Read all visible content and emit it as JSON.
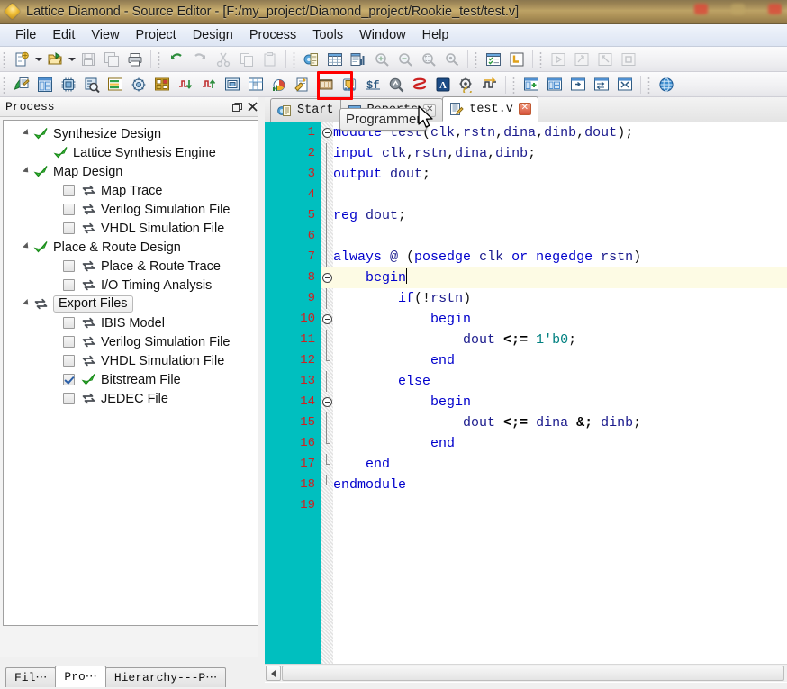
{
  "window": {
    "title": "Lattice Diamond - Source Editor - [F:/my_project/Diamond_project/Rookie_test/test.v]",
    "app_icon": "diamond-icon"
  },
  "menubar": {
    "items": [
      {
        "label": "File"
      },
      {
        "label": "Edit"
      },
      {
        "label": "View"
      },
      {
        "label": "Project"
      },
      {
        "label": "Design"
      },
      {
        "label": "Process"
      },
      {
        "label": "Tools"
      },
      {
        "label": "Window"
      },
      {
        "label": "Help"
      }
    ]
  },
  "toolbar_row1": {
    "groups": [
      {
        "buttons": [
          {
            "name": "new-file-icon",
            "kind": "newfile"
          },
          {
            "name": "new-file-dropdown-icon",
            "kind": "caret"
          },
          {
            "name": "open-file-icon",
            "kind": "openfile"
          },
          {
            "name": "open-file-dropdown-icon",
            "kind": "caret"
          },
          {
            "name": "save-icon",
            "kind": "save",
            "disabled": true
          },
          {
            "name": "save-all-icon",
            "kind": "saveall",
            "disabled": true
          },
          {
            "name": "print-icon",
            "kind": "print"
          }
        ]
      },
      {
        "buttons": [
          {
            "name": "undo-icon",
            "kind": "undo"
          },
          {
            "name": "redo-icon",
            "kind": "redo",
            "disabled": true
          },
          {
            "name": "cut-icon",
            "kind": "cut",
            "disabled": true
          },
          {
            "name": "copy-icon",
            "kind": "copy",
            "disabled": true
          },
          {
            "name": "paste-icon",
            "kind": "paste",
            "disabled": true
          }
        ]
      },
      {
        "buttons": [
          {
            "name": "report-icon",
            "kind": "report"
          },
          {
            "name": "spreadsheet-icon",
            "kind": "spreadsheet"
          },
          {
            "name": "find-in-files-icon",
            "kind": "findfiles"
          },
          {
            "name": "zoom-in-icon",
            "kind": "zoomin",
            "disabled": true
          },
          {
            "name": "zoom-out-icon",
            "kind": "zoomout",
            "disabled": true
          },
          {
            "name": "zoom-fit-icon",
            "kind": "zoomfit",
            "disabled": true
          },
          {
            "name": "zoom-select-icon",
            "kind": "zoomsel",
            "disabled": true
          }
        ]
      },
      {
        "buttons": [
          {
            "name": "task-list-icon",
            "kind": "tasklist"
          },
          {
            "name": "lattice-l-icon",
            "kind": "lattice"
          }
        ]
      },
      {
        "buttons": [
          {
            "name": "run-icon",
            "kind": "run",
            "disabled": true
          },
          {
            "name": "run-step-icon",
            "kind": "runstep",
            "disabled": true
          },
          {
            "name": "rerun-icon",
            "kind": "rerun",
            "disabled": true
          },
          {
            "name": "stop-icon",
            "kind": "stop",
            "disabled": true
          }
        ]
      }
    ]
  },
  "toolbar_row2": {
    "groups": [
      {
        "buttons": [
          {
            "name": "source-editor-icon",
            "kind": "srceditor"
          },
          {
            "name": "spreadsheet-view-icon",
            "kind": "sheetview"
          },
          {
            "name": "device-view-icon",
            "kind": "device"
          },
          {
            "name": "netlist-analyzer-icon",
            "kind": "netlist"
          },
          {
            "name": "floorplan-list-icon",
            "kind": "floorlist"
          },
          {
            "name": "package-view-icon",
            "kind": "package"
          },
          {
            "name": "floorplan-view-icon",
            "kind": "floorplan"
          },
          {
            "name": "timing-down-icon",
            "kind": "timingdown"
          },
          {
            "name": "timing-up-icon",
            "kind": "timingup"
          },
          {
            "name": "physical-view-icon",
            "kind": "physview"
          },
          {
            "name": "routing-view-icon",
            "kind": "routeview"
          },
          {
            "name": "power-calculator-icon",
            "kind": "power"
          },
          {
            "name": "ecо-editor-icon",
            "kind": "eco"
          },
          {
            "name": "memory-icon",
            "kind": "memory"
          },
          {
            "name": "programmer-icon",
            "kind": "programmer",
            "highlighted": true
          },
          {
            "name": "simulation-wizard-icon",
            "kind": "simwiz"
          },
          {
            "name": "reveal-inserter-icon",
            "kind": "reveal"
          },
          {
            "name": "reveal-analyzer-icon",
            "kind": "revealana"
          },
          {
            "name": "synplify-icon",
            "kind": "synplify"
          },
          {
            "name": "clarity-designer-icon",
            "kind": "clarity"
          },
          {
            "name": "timing-waveform-icon",
            "kind": "timingwave"
          }
        ]
      },
      {
        "buttons": [
          {
            "name": "new-window-icon",
            "kind": "newwin"
          },
          {
            "name": "tile-window-icon",
            "kind": "tilewin"
          },
          {
            "name": "float-window-icon",
            "kind": "floatwin"
          },
          {
            "name": "dock-window-icon",
            "kind": "dockwin"
          },
          {
            "name": "arrange-window-icon",
            "kind": "arrangewin"
          }
        ]
      },
      {
        "buttons": [
          {
            "name": "web-help-icon",
            "kind": "globe"
          }
        ]
      }
    ]
  },
  "process_panel": {
    "title": "Process",
    "float_button": "restore-icon",
    "close_button": "close-icon",
    "tree": [
      {
        "label": "Synthesize Design",
        "level": 0,
        "twisty": true,
        "checkbox": null,
        "icon": "green-check-icon"
      },
      {
        "label": "Lattice Synthesis Engine",
        "level": 1,
        "twisty": false,
        "checkbox": null,
        "icon": "green-check-icon"
      },
      {
        "label": "Map Design",
        "level": 0,
        "twisty": true,
        "checkbox": null,
        "icon": "green-check-icon"
      },
      {
        "label": "Map Trace",
        "level": 2,
        "twisty": false,
        "checkbox": "unchecked",
        "icon": "sync-arrows-icon"
      },
      {
        "label": "Verilog Simulation File",
        "level": 2,
        "twisty": false,
        "checkbox": "unchecked",
        "icon": "sync-arrows-icon"
      },
      {
        "label": "VHDL Simulation File",
        "level": 2,
        "twisty": false,
        "checkbox": "unchecked",
        "icon": "sync-arrows-icon"
      },
      {
        "label": "Place & Route Design",
        "level": 0,
        "twisty": true,
        "checkbox": null,
        "icon": "green-check-icon"
      },
      {
        "label": "Place & Route Trace",
        "level": 2,
        "twisty": false,
        "checkbox": "unchecked",
        "icon": "sync-arrows-icon"
      },
      {
        "label": "I/O Timing Analysis",
        "level": 2,
        "twisty": false,
        "checkbox": "unchecked",
        "icon": "sync-arrows-icon"
      },
      {
        "label": "Export Files",
        "level": 0,
        "twisty": true,
        "checkbox": null,
        "icon": "sync-arrows-icon",
        "selected": true
      },
      {
        "label": "IBIS Model",
        "level": 2,
        "twisty": false,
        "checkbox": "unchecked",
        "icon": "sync-arrows-icon"
      },
      {
        "label": "Verilog Simulation File",
        "level": 2,
        "twisty": false,
        "checkbox": "unchecked",
        "icon": "sync-arrows-icon"
      },
      {
        "label": "VHDL Simulation File",
        "level": 2,
        "twisty": false,
        "checkbox": "unchecked",
        "icon": "sync-arrows-icon"
      },
      {
        "label": "Bitstream File",
        "level": 2,
        "twisty": false,
        "checkbox": "checked",
        "icon": "green-check-icon"
      },
      {
        "label": "JEDEC File",
        "level": 2,
        "twisty": false,
        "checkbox": "unchecked",
        "icon": "sync-arrows-icon"
      }
    ],
    "bottom_tabs": [
      {
        "label": "Fil⋯",
        "active": false
      },
      {
        "label": "Pro⋯",
        "active": true
      },
      {
        "label": "Hierarchy---P⋯",
        "active": false
      }
    ]
  },
  "editor": {
    "tabs": [
      {
        "label": "Start",
        "icon": "start-page-icon",
        "closable": false,
        "active": false
      },
      {
        "label": "Reports",
        "icon": "reports-icon",
        "closable": true,
        "active": false
      },
      {
        "label": "test.v",
        "icon": "verilog-file-icon",
        "closable": true,
        "active": true
      }
    ],
    "gutter_color": "#00bfbf",
    "line_number_color": "#d02020",
    "highlight_line": 8,
    "cursor_line": 8,
    "lines": [
      {
        "n": 1,
        "fold": "open",
        "text": "module test(clk,rstn,dina,dinb,dout);"
      },
      {
        "n": 2,
        "fold": "bar",
        "text": "input clk,rstn,dina,dinb;"
      },
      {
        "n": 3,
        "fold": "bar",
        "text": "output dout;"
      },
      {
        "n": 4,
        "fold": "bar",
        "text": ""
      },
      {
        "n": 5,
        "fold": "bar",
        "text": "reg dout;"
      },
      {
        "n": 6,
        "fold": "bar",
        "text": ""
      },
      {
        "n": 7,
        "fold": "bar",
        "text": "always @ (posedge clk or negedge rstn)"
      },
      {
        "n": 8,
        "fold": "open",
        "text": "    begin"
      },
      {
        "n": 9,
        "fold": "bar",
        "text": "        if(!rstn)"
      },
      {
        "n": 10,
        "fold": "open",
        "text": "            begin"
      },
      {
        "n": 11,
        "fold": "bar",
        "text": "                dout <= 1'b0;"
      },
      {
        "n": 12,
        "fold": "end",
        "text": "            end"
      },
      {
        "n": 13,
        "fold": "bar",
        "text": "        else"
      },
      {
        "n": 14,
        "fold": "open",
        "text": "            begin"
      },
      {
        "n": 15,
        "fold": "bar",
        "text": "                dout <= dina & dinb;"
      },
      {
        "n": 16,
        "fold": "end",
        "text": "            end"
      },
      {
        "n": 17,
        "fold": "end",
        "text": "    end"
      },
      {
        "n": 18,
        "fold": "end",
        "text": "endmodule"
      },
      {
        "n": 19,
        "fold": "none",
        "text": ""
      }
    ],
    "hscroll": {
      "left_arrow": "scroll-left-icon"
    }
  },
  "tooltip": {
    "text": "Programmer"
  },
  "colors": {
    "gutter": "#00bfbf",
    "line_number": "#d02020",
    "keyword": "#0000cc",
    "number": "#008080",
    "highlight_row": "#fdfbe4",
    "highlight_box": "#ff0000",
    "titlebar": "#b89c5f"
  }
}
